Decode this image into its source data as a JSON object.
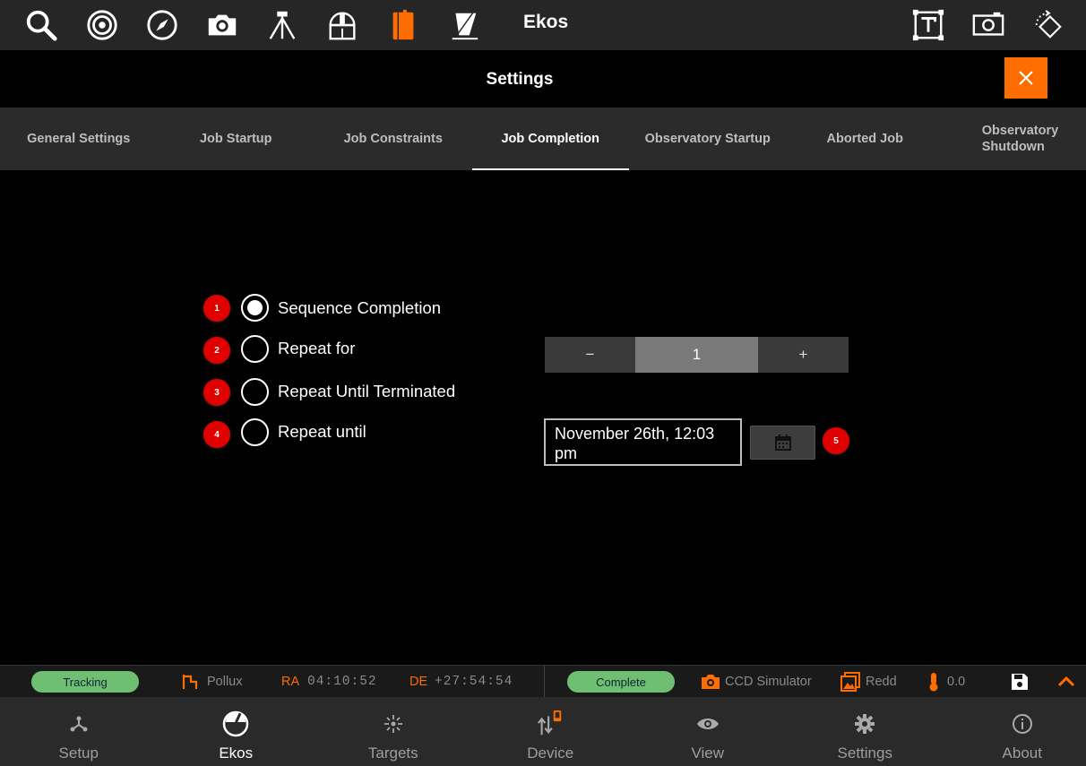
{
  "toolbar": {
    "app_title": "Ekos",
    "icons": [
      "search-icon",
      "target-icon",
      "compass-icon",
      "camera-icon",
      "tripod-icon",
      "observatory-icon",
      "notebook-icon",
      "flat-panel-icon",
      "text-frame-icon",
      "screenshot-icon",
      "rotate-icon"
    ],
    "accent": "#ff6d00"
  },
  "settings": {
    "title": "Settings",
    "close_icon": "close-icon"
  },
  "tabs": [
    {
      "label": "General Settings",
      "active": false
    },
    {
      "label": "Job Startup",
      "active": false
    },
    {
      "label": "Job Constraints",
      "active": false
    },
    {
      "label": "Job Completion",
      "active": true
    },
    {
      "label": "Observatory Startup",
      "active": false
    },
    {
      "label": "Aborted Job",
      "active": false
    },
    {
      "label": "Observatory Shutdown",
      "active": false
    }
  ],
  "options": [
    {
      "badge": "1",
      "label": "Sequence Completion",
      "checked": true
    },
    {
      "badge": "2",
      "label": "Repeat for",
      "checked": false
    },
    {
      "badge": "3",
      "label": "Repeat Until Terminated",
      "checked": false
    },
    {
      "badge": "4",
      "label": "Repeat until",
      "checked": false
    }
  ],
  "stepper": {
    "minus": "−",
    "value": "1",
    "plus": "+"
  },
  "date": {
    "value": "November 26th, 12:03 pm",
    "calendar_icon": "calendar-icon",
    "badge": "5"
  },
  "status": {
    "mount_state": "Tracking",
    "target": "Pollux",
    "ra_label": "RA",
    "ra_value": "04:10:52",
    "de_label": "DE",
    "de_value": "+27:54:54",
    "capture_state": "Complete",
    "camera": "CCD Simulator",
    "filter": "Redd",
    "temperature": "0.0",
    "pill_color": "#6fbf73"
  },
  "nav": [
    {
      "label": "Setup",
      "icon": "setup-icon",
      "active": false
    },
    {
      "label": "Ekos",
      "icon": "ekos-icon",
      "active": true
    },
    {
      "label": "Targets",
      "icon": "targets-icon",
      "active": false
    },
    {
      "label": "Device",
      "icon": "device-icon",
      "active": false
    },
    {
      "label": "View",
      "icon": "view-icon",
      "active": false
    },
    {
      "label": "Settings",
      "icon": "settings-icon",
      "active": false
    },
    {
      "label": "About",
      "icon": "about-icon",
      "active": false
    }
  ]
}
